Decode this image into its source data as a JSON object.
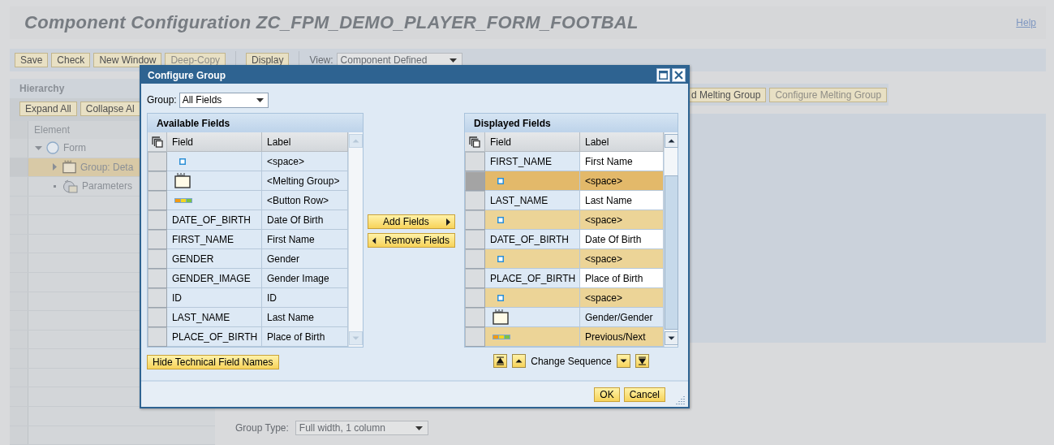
{
  "page": {
    "title": "Component Configuration ZC_FPM_DEMO_PLAYER_FORM_FOOTBAL",
    "help_link": "Help"
  },
  "toolbar": {
    "buttons": [
      {
        "label": "Save",
        "disabled": false
      },
      {
        "label": "Check",
        "disabled": false
      },
      {
        "label": "New Window",
        "disabled": false
      },
      {
        "label": "Deep-Copy",
        "disabled": true
      }
    ],
    "display_button": "Display",
    "view_label": "View:",
    "view_value": "Component Defined"
  },
  "hierarchy": {
    "title": "Hierarchy",
    "buttons": [
      "Expand All",
      "Collapse Al"
    ],
    "column": "Element",
    "tree": [
      {
        "kind": "form",
        "label": "Form",
        "expanded": true,
        "selected": false,
        "children": [
          {
            "kind": "group",
            "label": "Group: Deta",
            "expanded": false,
            "selected": true
          },
          {
            "kind": "parameters",
            "label": "Parameters",
            "selected": false
          }
        ]
      }
    ]
  },
  "melting_buttons": [
    {
      "label": "d Melting Group",
      "disabled": false
    },
    {
      "label": "Configure Melting Group",
      "disabled": true
    }
  ],
  "group_type": {
    "label": "Group Type:",
    "value": "Full width, 1 column"
  },
  "dialog": {
    "title": "Configure Group",
    "group_label": "Group:",
    "group_value": "All Fields",
    "available": {
      "title": "Available Fields",
      "columns": [
        "Field",
        "Label"
      ],
      "rows": [
        {
          "kind": "space",
          "label": "<space>",
          "selected": false
        },
        {
          "kind": "melting_group",
          "label": "<Melting Group>",
          "selected": false
        },
        {
          "kind": "button_row",
          "label": "<Button Row>",
          "selected": false
        },
        {
          "kind": "field",
          "field": "DATE_OF_BIRTH",
          "label": "Date Of Birth",
          "selected": false
        },
        {
          "kind": "field",
          "field": "FIRST_NAME",
          "label": "First Name",
          "selected": false
        },
        {
          "kind": "field",
          "field": "GENDER",
          "label": "Gender",
          "selected": false
        },
        {
          "kind": "field",
          "field": "GENDER_IMAGE",
          "label": "Gender Image",
          "selected": false
        },
        {
          "kind": "field",
          "field": "ID",
          "label": "ID",
          "selected": false
        },
        {
          "kind": "field",
          "field": "LAST_NAME",
          "label": "Last Name",
          "selected": false
        },
        {
          "kind": "field",
          "field": "PLACE_OF_BIRTH",
          "label": "Place of Birth",
          "selected": false
        }
      ]
    },
    "add_button": "Add Fields",
    "remove_button": "Remove Fields",
    "displayed": {
      "title": "Displayed Fields",
      "columns": [
        "Field",
        "Label"
      ],
      "rows": [
        {
          "kind": "field",
          "field": "FIRST_NAME",
          "label": "First Name",
          "selected": false
        },
        {
          "kind": "space",
          "label": "<space>",
          "selected": true
        },
        {
          "kind": "field",
          "field": "LAST_NAME",
          "label": "Last Name",
          "selected": false
        },
        {
          "kind": "space",
          "label": "<space>",
          "selected": false
        },
        {
          "kind": "field",
          "field": "DATE_OF_BIRTH",
          "label": "Date Of Birth",
          "selected": false
        },
        {
          "kind": "space",
          "label": "<space>",
          "selected": false
        },
        {
          "kind": "field",
          "field": "PLACE_OF_BIRTH",
          "label": "Place of Birth",
          "selected": false
        },
        {
          "kind": "space",
          "label": "<space>",
          "selected": false
        },
        {
          "kind": "melting_group",
          "label": "Gender/Gender",
          "selected": false
        },
        {
          "kind": "button_row",
          "label": "Previous/Next",
          "selected": false
        }
      ]
    },
    "hide_button": "Hide Technical Field Names",
    "sequence_label": "Change Sequence",
    "ok_button": "OK",
    "cancel_button": "Cancel"
  }
}
